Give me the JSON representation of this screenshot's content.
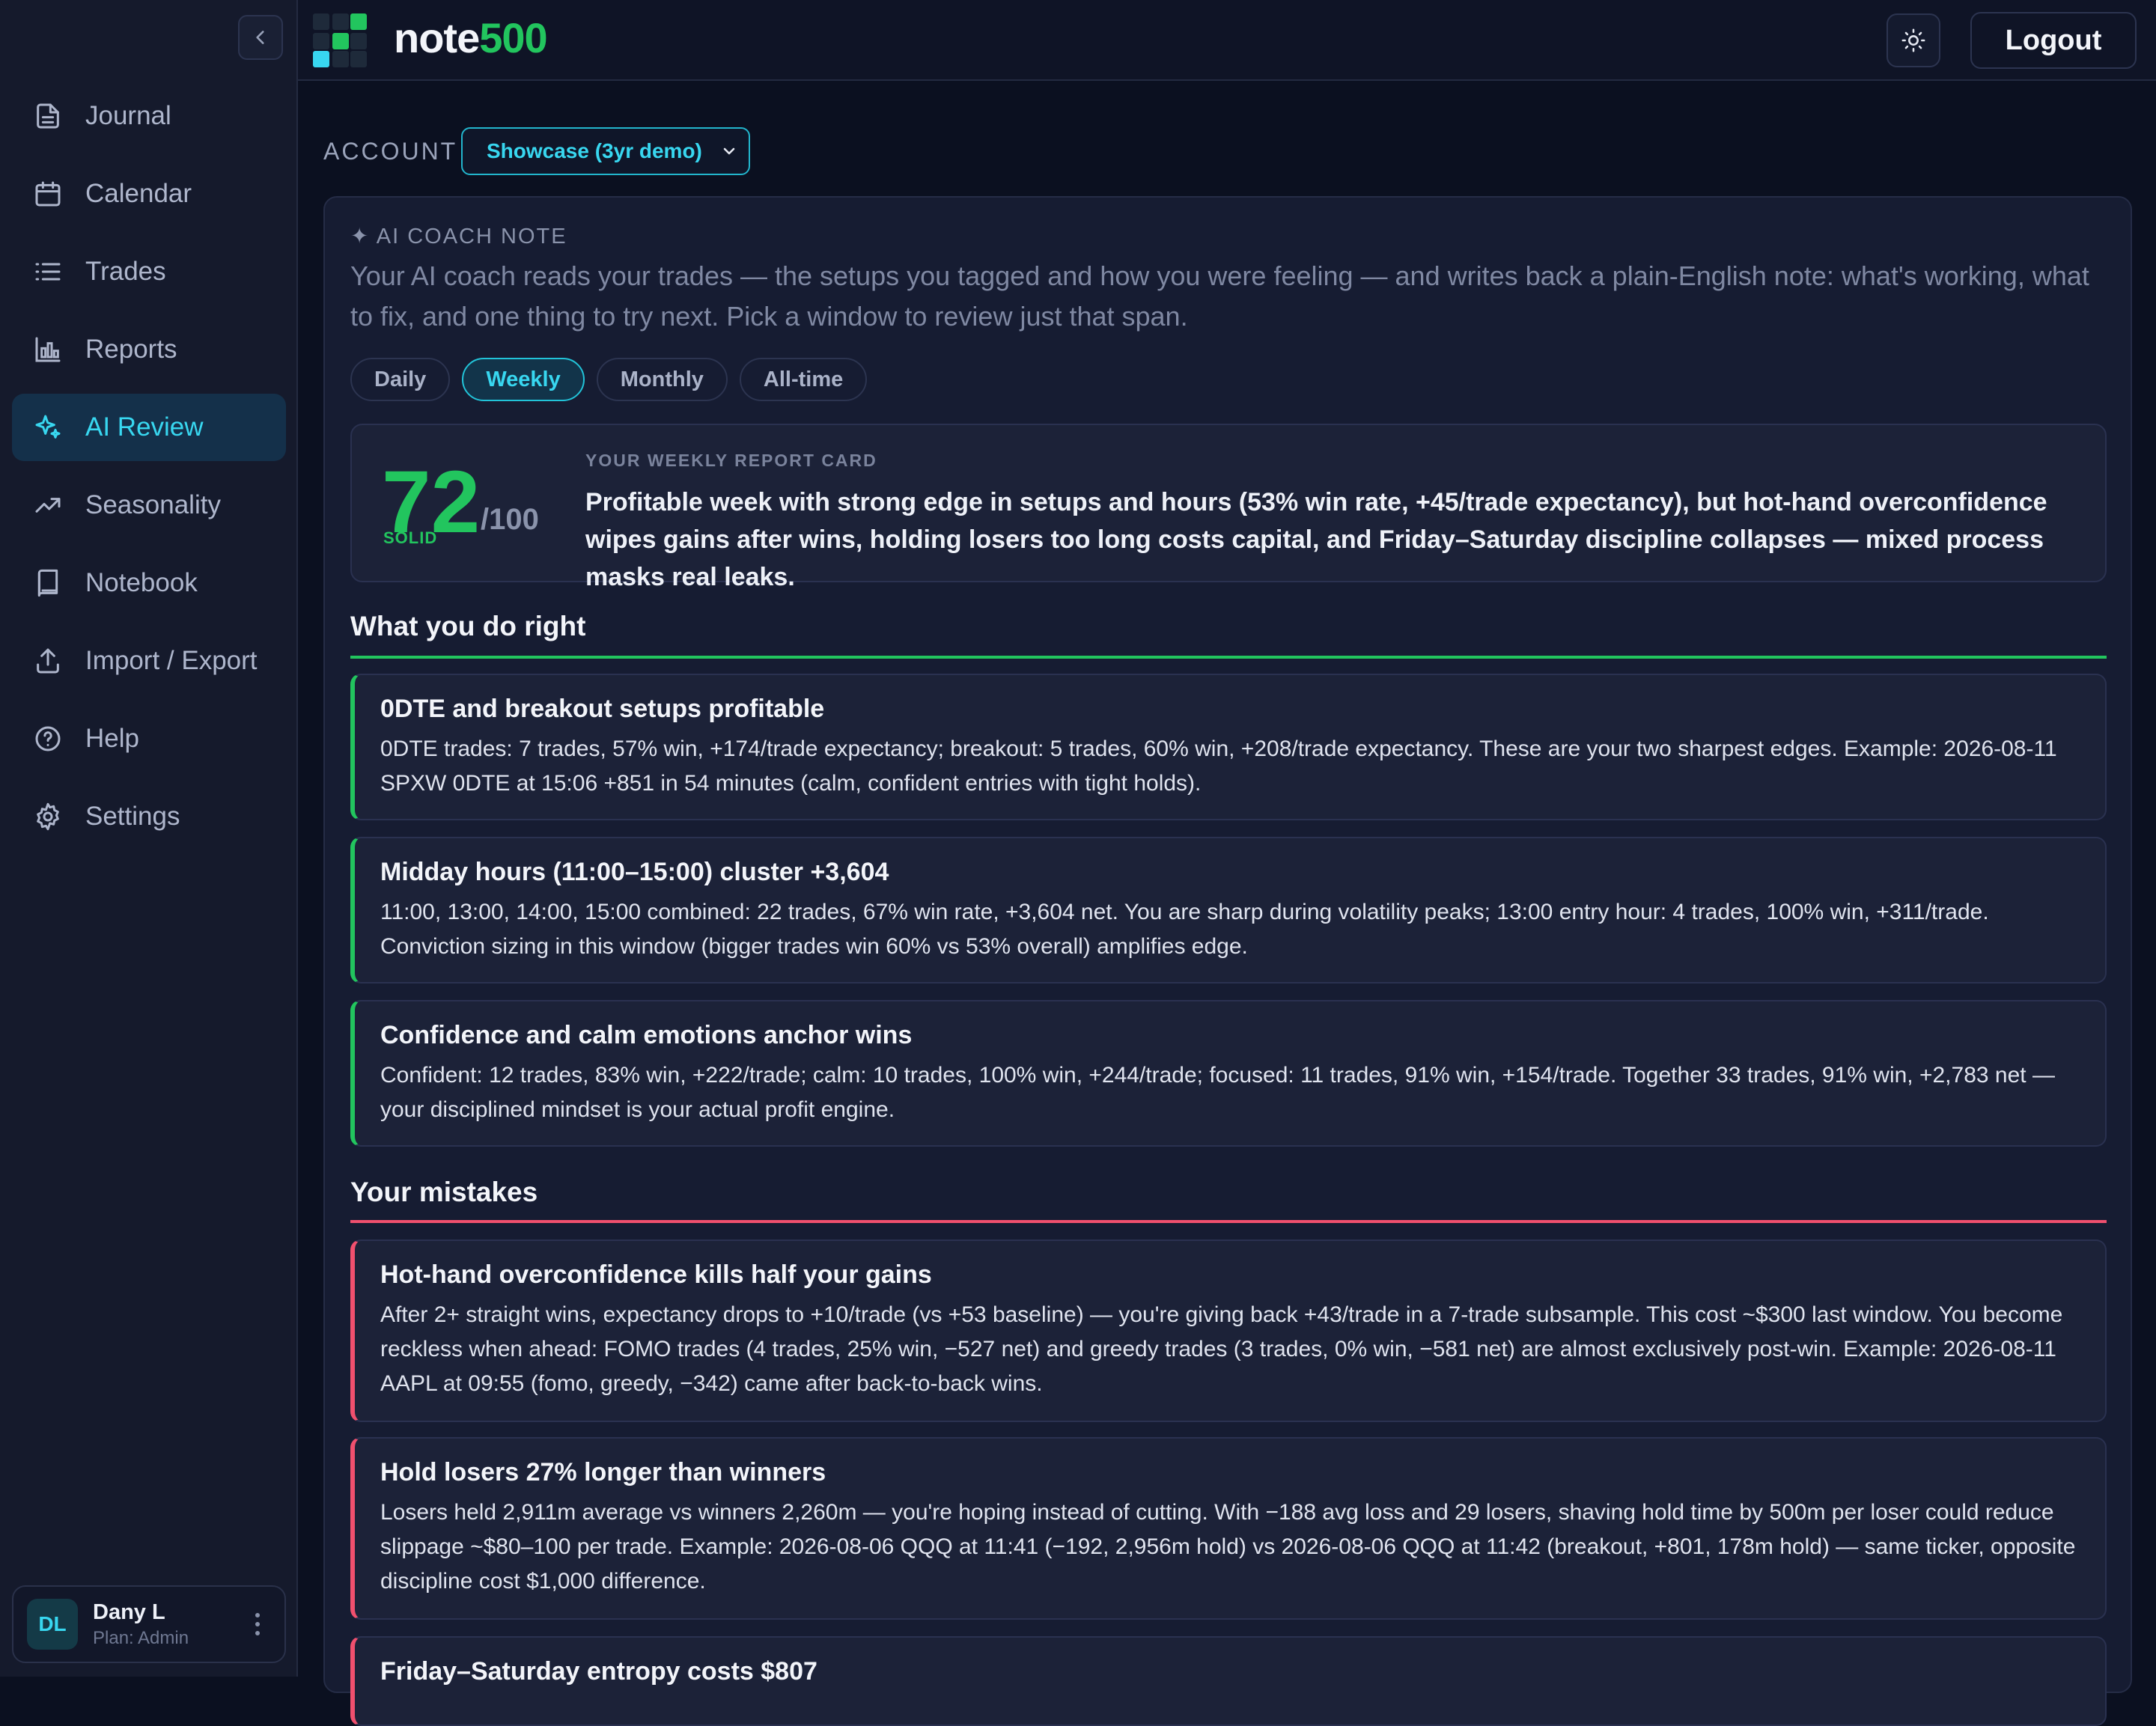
{
  "brand": {
    "name_part1": "note",
    "name_part2": "500"
  },
  "header": {
    "logout_label": "Logout"
  },
  "sidebar": {
    "items": [
      {
        "label": "Journal",
        "icon": "file-text-icon"
      },
      {
        "label": "Calendar",
        "icon": "calendar-icon"
      },
      {
        "label": "Trades",
        "icon": "list-icon"
      },
      {
        "label": "Reports",
        "icon": "bar-chart-icon"
      },
      {
        "label": "AI Review",
        "icon": "sparkles-icon",
        "active": true
      },
      {
        "label": "Seasonality",
        "icon": "trending-up-icon"
      },
      {
        "label": "Notebook",
        "icon": "book-icon"
      },
      {
        "label": "Import / Export",
        "icon": "upload-icon"
      },
      {
        "label": "Help",
        "icon": "help-circle-icon"
      },
      {
        "label": "Settings",
        "icon": "gear-icon"
      }
    ],
    "user": {
      "initials": "DL",
      "name": "Dany L",
      "plan": "Plan: Admin"
    }
  },
  "account": {
    "label": "ACCOUNT",
    "selected": "Showcase (3yr demo)"
  },
  "coach": {
    "label": "✦ AI COACH NOTE",
    "description": "Your AI coach reads your trades — the setups you tagged and how you were feeling — and writes back a plain‑English note: what's working, what to fix, and one thing to try next. Pick a window to review just that span."
  },
  "tabs": [
    {
      "label": "Daily"
    },
    {
      "label": "Weekly",
      "active": true
    },
    {
      "label": "Monthly"
    },
    {
      "label": "All-time"
    }
  ],
  "report_card": {
    "score": "72",
    "max": "/100",
    "grade": "SOLID",
    "label": "YOUR WEEKLY REPORT CARD",
    "summary": "Profitable week with strong edge in setups and hours (53% win rate, +45/trade expectancy), but hot‑hand overconfidence wipes gains after wins, holding losers too long costs capital, and Friday–Saturday discipline collapses — mixed process masks real leaks."
  },
  "right": {
    "title": "What you do right",
    "items": [
      {
        "title": "0DTE and breakout setups profitable",
        "body": "0DTE trades: 7 trades, 57% win, +174/trade expectancy; breakout: 5 trades, 60% win, +208/trade expectancy. These are your two sharpest edges. Example: 2026‑08‑11 SPXW 0DTE at 15:06 +851 in 54 minutes (calm, confident entries with tight holds)."
      },
      {
        "title": "Midday hours (11:00–15:00) cluster +3,604",
        "body": "11:00, 13:00, 14:00, 15:00 combined: 22 trades, 67% win rate, +3,604 net. You are sharp during volatility peaks; 13:00 entry hour: 4 trades, 100% win, +311/trade. Conviction sizing in this window (bigger trades win 60% vs 53% overall) amplifies edge."
      },
      {
        "title": "Confidence and calm emotions anchor wins",
        "body": "Confident: 12 trades, 83% win, +222/trade; calm: 10 trades, 100% win, +244/trade; focused: 11 trades, 91% win, +154/trade. Together 33 trades, 91% win, +2,783 net — your disciplined mindset is your actual profit engine."
      }
    ]
  },
  "mistakes": {
    "title": "Your mistakes",
    "items": [
      {
        "title": "Hot‑hand overconfidence kills half your gains",
        "body": "After 2+ straight wins, expectancy drops to +10/trade (vs +53 baseline) — you're giving back +43/trade in a 7‑trade subsample. This cost ~$300 last window. You become reckless when ahead: FOMO trades (4 trades, 25% win, −527 net) and greedy trades (3 trades, 0% win, −581 net) are almost exclusively post‑win. Example: 2026‑08‑11 AAPL at 09:55 (fomo, greedy, −342) came after back‑to‑back wins."
      },
      {
        "title": "Hold losers 27% longer than winners",
        "body": "Losers held 2,911m average vs winners 2,260m — you're hoping instead of cutting. With −188 avg loss and 29 losers, shaving hold time by 500m per loser could reduce slippage ~$80–100 per trade. Example: 2026‑08‑06 QQQ at 11:41 (−192, 2,956m hold) vs 2026‑08‑06 QQQ at 11:42 (breakout, +801, 178m hold) — same ticker, opposite discipline cost $1,000 difference."
      },
      {
        "title": "Friday–Saturday entropy costs $807",
        "body": ""
      }
    ]
  }
}
